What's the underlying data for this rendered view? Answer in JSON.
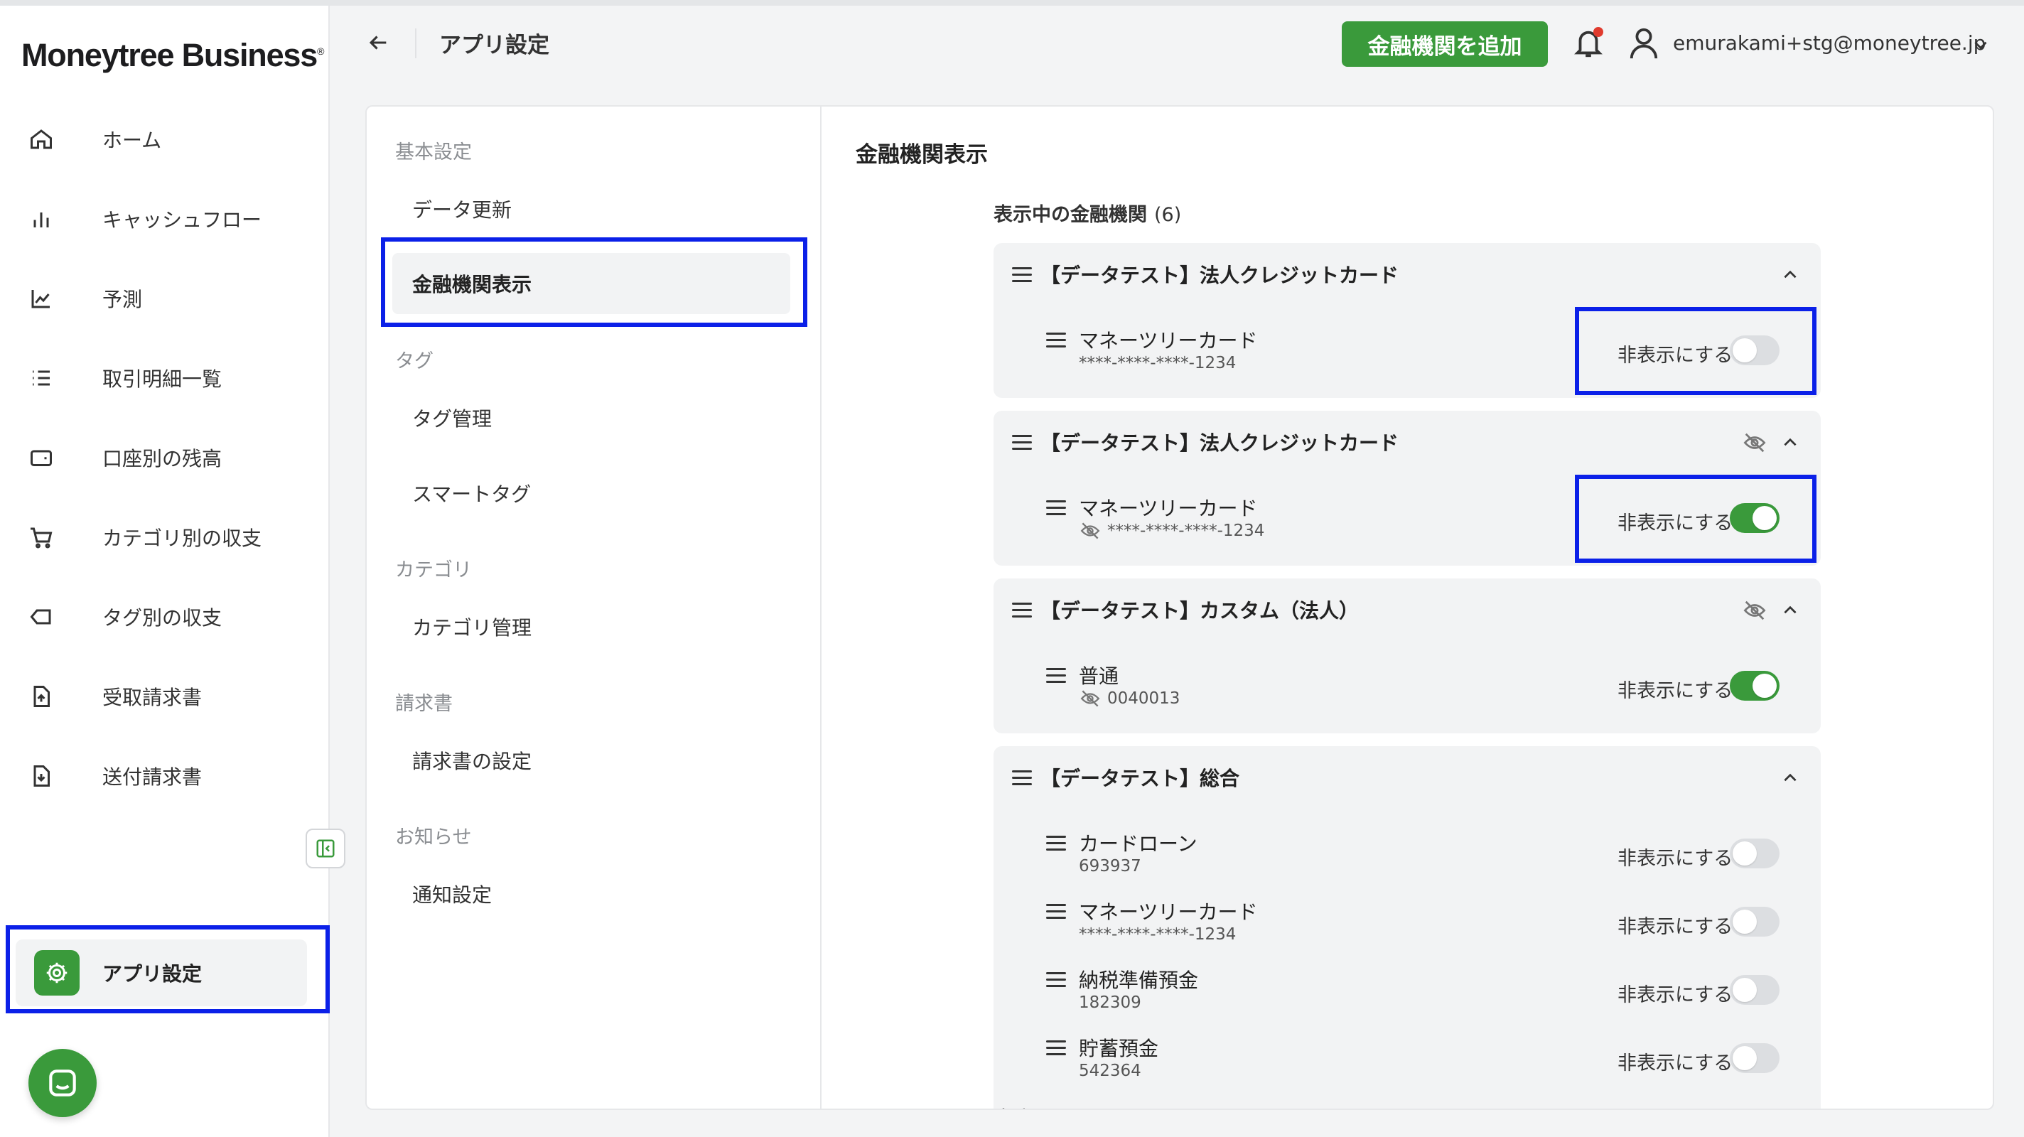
{
  "app": {
    "logo_text": "Moneytree Business",
    "logo_mark": "®"
  },
  "sidebar": {
    "items": [
      {
        "label": "ホーム",
        "icon": "home-icon"
      },
      {
        "label": "キャッシュフロー",
        "icon": "bar-chart-icon"
      },
      {
        "label": "予測",
        "icon": "line-chart-icon"
      },
      {
        "label": "取引明細一覧",
        "icon": "list-icon"
      },
      {
        "label": "口座別の残高",
        "icon": "wallet-icon"
      },
      {
        "label": "カテゴリ別の収支",
        "icon": "cart-icon"
      },
      {
        "label": "タグ別の収支",
        "icon": "tag-icon"
      },
      {
        "label": "受取請求書",
        "icon": "invoice-upload-icon"
      },
      {
        "label": "送付請求書",
        "icon": "invoice-download-icon"
      }
    ],
    "active_item": {
      "label": "アプリ設定",
      "icon": "gear-icon"
    }
  },
  "header": {
    "title": "アプリ設定",
    "add_button_label": "金融機関を追加",
    "user_email": "emurakami+stg@moneytree.jp"
  },
  "settings_menu": {
    "sections": [
      {
        "title": "基本設定",
        "items": [
          "データ更新",
          "金融機関表示"
        ]
      },
      {
        "title": "タグ",
        "items": [
          "タグ管理",
          "スマートタグ"
        ]
      },
      {
        "title": "カテゴリ",
        "items": [
          "カテゴリ管理"
        ]
      },
      {
        "title": "請求書",
        "items": [
          "請求書の設定"
        ]
      },
      {
        "title": "お知らせ",
        "items": [
          "通知設定"
        ]
      }
    ],
    "active_item": "金融機関表示"
  },
  "content": {
    "title": "金融機関表示",
    "list_header": "表示中の金融機関",
    "list_count": "(6)",
    "hide_label": "非表示にする",
    "groups": [
      {
        "name": "【データテスト】法人クレジットカード",
        "hidden_icon": false,
        "accounts": [
          {
            "name": "マネーツリーカード",
            "number": "****-****-****-1234",
            "hidden": false
          }
        ]
      },
      {
        "name": "【データテスト】法人クレジットカード",
        "hidden_icon": true,
        "accounts": [
          {
            "name": "マネーツリーカード",
            "number": "****-****-****-1234",
            "hidden": true
          }
        ]
      },
      {
        "name": "【データテスト】カスタム（法人）",
        "hidden_icon": true,
        "accounts": [
          {
            "name": "普通",
            "number": "0040013",
            "hidden": true
          }
        ]
      },
      {
        "name": "【データテスト】総合",
        "hidden_icon": false,
        "accounts": [
          {
            "name": "カードローン",
            "number": "693937",
            "hidden": false
          },
          {
            "name": "マネーツリーカード",
            "number": "****-****-****-1234",
            "hidden": false
          },
          {
            "name": "納税準備預金",
            "number": "182309",
            "hidden": false
          },
          {
            "name": "貯蓄預金",
            "number": "542364",
            "hidden": false
          }
        ]
      }
    ],
    "peek_item": "当座"
  },
  "colors": {
    "accent": "#3a9a3b",
    "highlight": "#0b20e8",
    "notification": "#e03b2e"
  }
}
